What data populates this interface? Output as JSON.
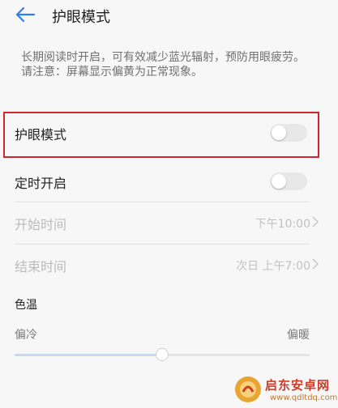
{
  "header": {
    "title": "护眼模式",
    "back_icon": "arrow-left-icon"
  },
  "description": {
    "line1": "长期阅读时开启，可有效减少蓝光辐射，预防用眼疲劳。",
    "line2": "请注意：屏幕显示偏黄为正常现象。"
  },
  "eye_mode": {
    "label": "护眼模式",
    "enabled": false
  },
  "schedule": {
    "label": "定时开启",
    "enabled": false
  },
  "start_time": {
    "label": "开始时间",
    "value": "下午10:00"
  },
  "end_time": {
    "label": "结束时间",
    "value": "次日 上午7:00"
  },
  "color_temp": {
    "section_title": "色温",
    "cold_label": "偏冷",
    "warm_label": "偏暖",
    "level": 0.5
  },
  "watermark": {
    "name": "启东安卓网",
    "url": "www.qdltdq.com"
  },
  "colors": {
    "accent": "#2e7cf6",
    "highlight_border": "#d0262d",
    "toggle_off": "#e8e8e8"
  }
}
